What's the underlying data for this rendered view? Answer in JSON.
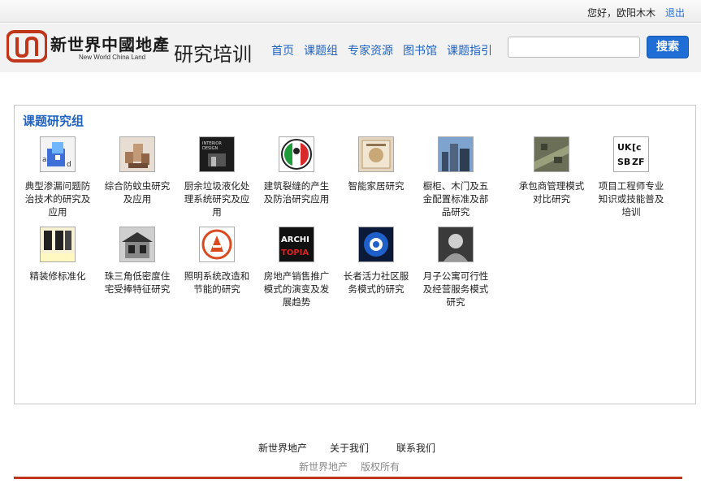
{
  "topbar": {
    "greeting": "您好，欧阳木木",
    "logout": "退出"
  },
  "header": {
    "logo_cn": "新世界中國地產",
    "logo_en": "New World China Land",
    "site_title": "研究培训",
    "nav": [
      "首页",
      "课题组",
      "专家资源",
      "图书馆",
      "课题指引"
    ],
    "search_placeholder": "",
    "search_button": "搜索"
  },
  "panel": {
    "title": "课题研究组",
    "items": [
      {
        "label": "典型渗漏问题防治技术的研究及应用",
        "icon": "house-sketch-icon"
      },
      {
        "label": "综合防蚊虫研究及应用",
        "icon": "building-model-icon"
      },
      {
        "label": "厨余垃圾液化处理系统研究及应用",
        "icon": "interior-design-icon"
      },
      {
        "label": "建筑裂缝的产生及防治研究应用",
        "icon": "italian-emblem-icon"
      },
      {
        "label": "智能家居研究",
        "icon": "certificate-icon"
      },
      {
        "label": "橱柜、木门及五金配置标准及部品研究",
        "icon": "city-skyline-icon"
      },
      {
        "label": "承包商管理模式对比研究",
        "icon": "aerial-city-icon"
      },
      {
        "label": "项目工程师专业知识或技能普及培训",
        "icon": "calligraphy-icon"
      },
      {
        "label": "精装修标准化",
        "icon": "signboard-icon"
      },
      {
        "label": "珠三角低密度住宅受捧特征研究",
        "icon": "villa-photo-icon"
      },
      {
        "label": "照明系统改造和节能的研究",
        "icon": "seal-emblem-icon"
      },
      {
        "label": "房地产销售推广模式的演变及发展趋势",
        "icon": "architopia-icon"
      },
      {
        "label": "长者活力社区服务模式的研究",
        "icon": "blue-circle-icon"
      },
      {
        "label": "月子公寓可行性及经营服务模式研究",
        "icon": "portrait-icon"
      }
    ]
  },
  "footer": {
    "links": [
      "新世界地产",
      "关于我们",
      "联系我们"
    ],
    "copyright_company": "新世界地产",
    "copyright_text": "版权所有"
  },
  "colors": {
    "link": "#1f63c2",
    "search_button": "#1f6ed6",
    "footer_line": "#c0361b",
    "logo": "#c0361b"
  }
}
